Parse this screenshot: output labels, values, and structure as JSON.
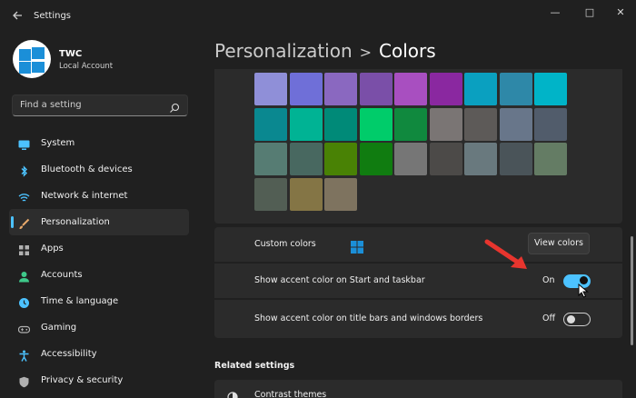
{
  "window": {
    "title": "Settings",
    "controls": [
      "—",
      "□",
      "✕"
    ]
  },
  "user": {
    "name": "TWC",
    "account_type": "Local Account"
  },
  "search": {
    "placeholder": "Find a setting"
  },
  "sidebar": {
    "items": [
      {
        "label": "System",
        "icon": "monitor-icon",
        "color": "#4cc2ff"
      },
      {
        "label": "Bluetooth & devices",
        "icon": "bluetooth-icon",
        "color": "#4cc2ff"
      },
      {
        "label": "Network & internet",
        "icon": "wifi-icon",
        "color": "#4cc2ff"
      },
      {
        "label": "Personalization",
        "icon": "brush-icon",
        "color": "#e8a96b",
        "selected": true
      },
      {
        "label": "Apps",
        "icon": "apps-icon",
        "color": "#b0b0b0"
      },
      {
        "label": "Accounts",
        "icon": "person-icon",
        "color": "#3ec98a"
      },
      {
        "label": "Time & language",
        "icon": "globe-clock-icon",
        "color": "#4cc2ff"
      },
      {
        "label": "Gaming",
        "icon": "gamepad-icon",
        "color": "#b0b0b0"
      },
      {
        "label": "Accessibility",
        "icon": "accessibility-icon",
        "color": "#4cc2ff"
      },
      {
        "label": "Privacy & security",
        "icon": "shield-icon",
        "color": "#b0b0b0"
      }
    ]
  },
  "header": {
    "breadcrumb_parent": "Personalization",
    "separator": ">",
    "current": "Colors"
  },
  "palette": {
    "rows": [
      [
        "#8f8fd8",
        "#6f6fd8",
        "#8a68c0",
        "#7a4fa8",
        "#a84fc0",
        "#8a28a0",
        "#0aa0c0",
        "#2e88a8",
        "#00b4c8"
      ],
      [
        "#0a8890",
        "#00b394",
        "#008a78",
        "#00cc6a",
        "#10893e",
        "#7a7574",
        "#5d5a58",
        "#68768a",
        "#515c6b"
      ],
      [
        "#567c73",
        "#486860",
        "#498205",
        "#107c10",
        "#767676",
        "#4c4a48",
        "#69797e",
        "#4a5459",
        "#647c64"
      ],
      [
        "#525e54",
        "#847545",
        "#7e735f"
      ]
    ]
  },
  "rows": {
    "custom_colors": {
      "label": "Custom colors",
      "button": "View colors"
    },
    "accent_start": {
      "label": "Show accent color on Start and taskbar",
      "state": "On",
      "enabled": true
    },
    "accent_titlebars": {
      "label": "Show accent color on title bars and windows borders",
      "state": "Off",
      "enabled": false
    }
  },
  "related": {
    "heading": "Related settings",
    "items": [
      {
        "label": "Contrast themes",
        "icon": "contrast-icon"
      }
    ]
  },
  "colors": {
    "accent": "#4cc2ff",
    "background": "#202020",
    "card": "#2b2b2b",
    "annotation_arrow": "#e8352e"
  }
}
